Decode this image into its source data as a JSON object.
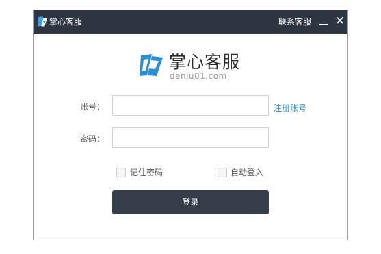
{
  "titlebar": {
    "title": "掌心客服",
    "contact_label": "联系客服",
    "minimize_glyph": "—",
    "close_glyph": "✕",
    "background": "#2f3643",
    "icon": "app-logo-icon"
  },
  "brand": {
    "name": "掌心客服",
    "url": "daniu01.com",
    "logo_color": "#2a8fd6",
    "icon": "brand-logo-icon"
  },
  "form": {
    "account_label": "账号：",
    "account_value": "",
    "password_label": "密码：",
    "password_value": "",
    "register_link": "注册账号",
    "remember_label": "记住密码",
    "remember_checked": false,
    "autologin_label": "自动登入",
    "autologin_checked": false,
    "login_button": "登录",
    "login_button_color": "#353d4a",
    "link_color": "#2f8fd3"
  }
}
